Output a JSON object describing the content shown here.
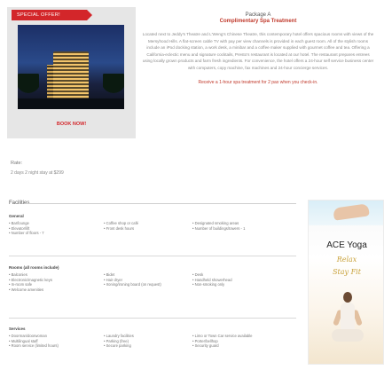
{
  "package": {
    "tag": "SPECIAL OFFER!",
    "book_now": "BOOK NOW!",
    "number": "Package A",
    "title": "Complimentary Spa Treatment",
    "description": "Located next to Jeddy's Theatre and L'Weng's Chinese Theatre, this contemporary hotel offers spacious rooms with views of the Mersyhood Hills. A flat-screen cable TV with pay per view channels is provided in each guest room. All of the stylish rooms include an iPod docking station, a work desk, a minibar and a coffee maker supplied with gourmet coffee and tea. Offering a California-eclectic menu and signature cocktails, Presto's restaurant is located at our hotel. The restaurant prepares entrees using locally grown products and farm fresh ingredients. For convenience, the hotel offers a 24-hour self service business center with computers, copy machine, fax machines and 24-hour concierge services.",
    "offer": "Receive a 1-hour spa treatment for 2 pax when you check-in."
  },
  "rate": {
    "label": "Rate:",
    "value": "2 days 2 night stay at $299"
  },
  "facilities": {
    "title": "Facilities",
    "sections": [
      {
        "heading": "General",
        "columns": [
          [
            "• Bar/lounge",
            "• Elevator/lift",
            "• Number of floors - 7"
          ],
          [
            "• Coffee shop or café",
            "• Front desk hours"
          ],
          [
            "• Designated smoking areas",
            "• Number of buildings/towers - 1"
          ]
        ]
      },
      {
        "heading": "Rooms (all rooms include)",
        "columns": [
          [
            "• Balconies",
            "• Electronic/magnetic keys",
            "• In-room safe",
            "• Welcome amenities"
          ],
          [
            "• Bidet",
            "• Hair dryer",
            "• Ironing/ironing board (on request)"
          ],
          [
            "• Desk",
            "• Handheld showerhead",
            "• Non-smoking only"
          ]
        ]
      },
      {
        "heading": "Services",
        "columns": [
          [
            "• Doorman/doorwoman",
            "• Multilingual staff",
            "• Room service (limited hours)"
          ],
          [
            "• Laundry facilities",
            "• Parking (free)",
            "• Secure parking"
          ],
          [
            "• Limo or Town Car service available",
            "• Porter/bellhop",
            "• Security guard"
          ]
        ]
      }
    ]
  },
  "ad": {
    "title": "ACE Yoga",
    "line1": "Relax",
    "line2": "Stay Fit"
  }
}
